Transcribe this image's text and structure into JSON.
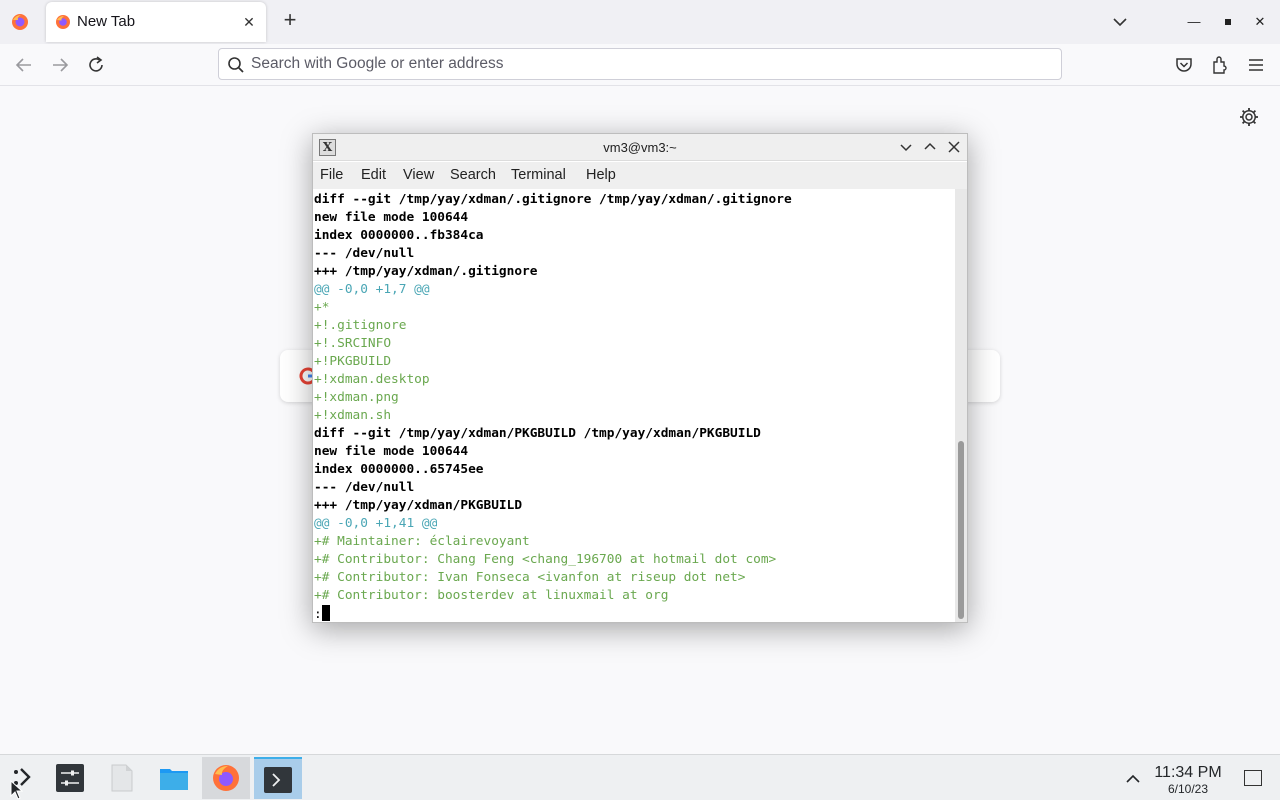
{
  "browser": {
    "tab": {
      "title": "New Tab",
      "close_symbol": "✕"
    },
    "new_tab_symbol": "+",
    "urlbar": {
      "placeholder": "Search with Google or enter address"
    },
    "window_controls": {
      "minimize": "—",
      "maximize": "▫",
      "close": "✕"
    }
  },
  "terminal": {
    "window_title": "vm3@vm3:~",
    "app_icon_letter": "X",
    "menu": [
      "File",
      "Edit",
      "View",
      "Search",
      "Terminal",
      "Help"
    ],
    "lines": [
      {
        "text": "diff --git /tmp/yay/xdman/.gitignore /tmp/yay/xdman/.gitignore",
        "style": "bold"
      },
      {
        "text": "new file mode 100644",
        "style": "bold"
      },
      {
        "text": "index 0000000..fb384ca",
        "style": "bold"
      },
      {
        "text": "--- /dev/null",
        "style": "bold"
      },
      {
        "text": "+++ /tmp/yay/xdman/.gitignore",
        "style": "bold"
      },
      {
        "text": "@@ -0,0 +1,7 @@",
        "style": "cyan"
      },
      {
        "text": "+*",
        "style": "green"
      },
      {
        "text": "+!.gitignore",
        "style": "green"
      },
      {
        "text": "+!.SRCINFO",
        "style": "green"
      },
      {
        "text": "+!PKGBUILD",
        "style": "green"
      },
      {
        "text": "+!xdman.desktop",
        "style": "green"
      },
      {
        "text": "+!xdman.png",
        "style": "green"
      },
      {
        "text": "+!xdman.sh",
        "style": "green"
      },
      {
        "text": "diff --git /tmp/yay/xdman/PKGBUILD /tmp/yay/xdman/PKGBUILD",
        "style": "bold"
      },
      {
        "text": "new file mode 100644",
        "style": "bold"
      },
      {
        "text": "index 0000000..65745ee",
        "style": "bold"
      },
      {
        "text": "--- /dev/null",
        "style": "bold"
      },
      {
        "text": "+++ /tmp/yay/xdman/PKGBUILD",
        "style": "bold"
      },
      {
        "text": "@@ -0,0 +1,41 @@",
        "style": "cyan"
      },
      {
        "text": "+# Maintainer: éclairevoyant",
        "style": "green"
      },
      {
        "text": "+# Contributor: Chang Feng <chang_196700 at hotmail dot com>",
        "style": "green"
      },
      {
        "text": "+# Contributor: Ivan Fonseca <ivanfon at riseup dot net>",
        "style": "green"
      },
      {
        "text": "+# Contributor: boosterdev at linuxmail at org",
        "style": "green"
      }
    ],
    "prompt": ":"
  },
  "taskbar": {
    "time": "11:34 PM",
    "date": "6/10/23"
  },
  "colors": {
    "diff_header": "#000000",
    "diff_hunk": "#4aa6b5",
    "diff_added": "#6aa84f",
    "taskbar_active_accent": "#3daee9"
  }
}
